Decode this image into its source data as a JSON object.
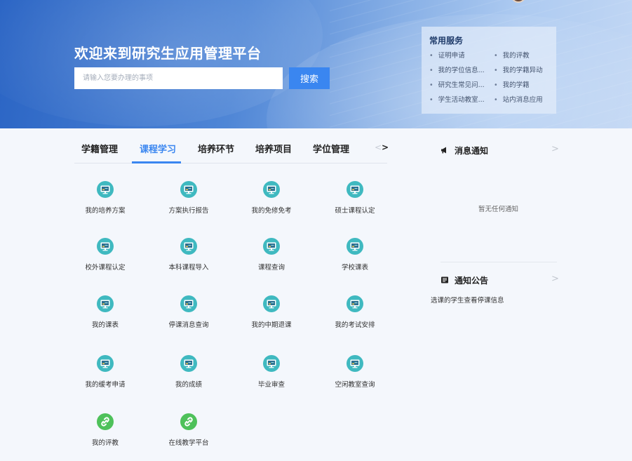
{
  "hero": {
    "title": "欢迎来到研究生应用管理平台",
    "search_placeholder": "请输入您要办理的事项",
    "search_button": "搜索"
  },
  "services": {
    "title": "常用服务",
    "items": [
      "证明申请",
      "我的评教",
      "我的学位信息...",
      "我的学籍异动",
      "研究生常见问...",
      "我的学籍",
      "学生活动教室...",
      "站内消息应用"
    ]
  },
  "tabs": {
    "items": [
      "学籍管理",
      "课程学习",
      "培养环节",
      "培养项目",
      "学位管理"
    ],
    "active_index": 1,
    "prev_icon": "chevron-left-icon",
    "next_icon": "chevron-right-icon"
  },
  "apps": [
    {
      "label": "我的培养方案",
      "icon": "monitor-icon"
    },
    {
      "label": "方案执行报告",
      "icon": "monitor-icon"
    },
    {
      "label": "我的免修免考",
      "icon": "monitor-icon"
    },
    {
      "label": "硕士课程认定",
      "icon": "monitor-icon"
    },
    {
      "label": "校外课程认定",
      "icon": "monitor-icon"
    },
    {
      "label": "本科课程导入",
      "icon": "monitor-icon"
    },
    {
      "label": "课程查询",
      "icon": "monitor-icon"
    },
    {
      "label": "学校课表",
      "icon": "monitor-icon"
    },
    {
      "label": "我的课表",
      "icon": "monitor-icon"
    },
    {
      "label": "停课消息查询",
      "icon": "monitor-icon"
    },
    {
      "label": "我的中期退课",
      "icon": "monitor-icon"
    },
    {
      "label": "我的考试安排",
      "icon": "monitor-icon"
    },
    {
      "label": "我的缓考申请",
      "icon": "monitor-icon"
    },
    {
      "label": "我的成绩",
      "icon": "monitor-icon"
    },
    {
      "label": "毕业审查",
      "icon": "monitor-icon"
    },
    {
      "label": "空闲教室查询",
      "icon": "monitor-icon"
    },
    {
      "label": "我的评教",
      "icon": "link-icon"
    },
    {
      "label": "在线教学平台",
      "icon": "link-icon"
    }
  ],
  "messages": {
    "title": "消息通知",
    "icon": "megaphone-icon",
    "empty_text": "暂无任何通知"
  },
  "notices": {
    "title": "通知公告",
    "icon": "notice-board-icon",
    "items": [
      "选课的学生查看停课信息"
    ]
  },
  "colors": {
    "accent": "#3a86f0",
    "monitor_icon_bg": "#3fb9c0",
    "link_icon_bg": "#4ec15a"
  }
}
